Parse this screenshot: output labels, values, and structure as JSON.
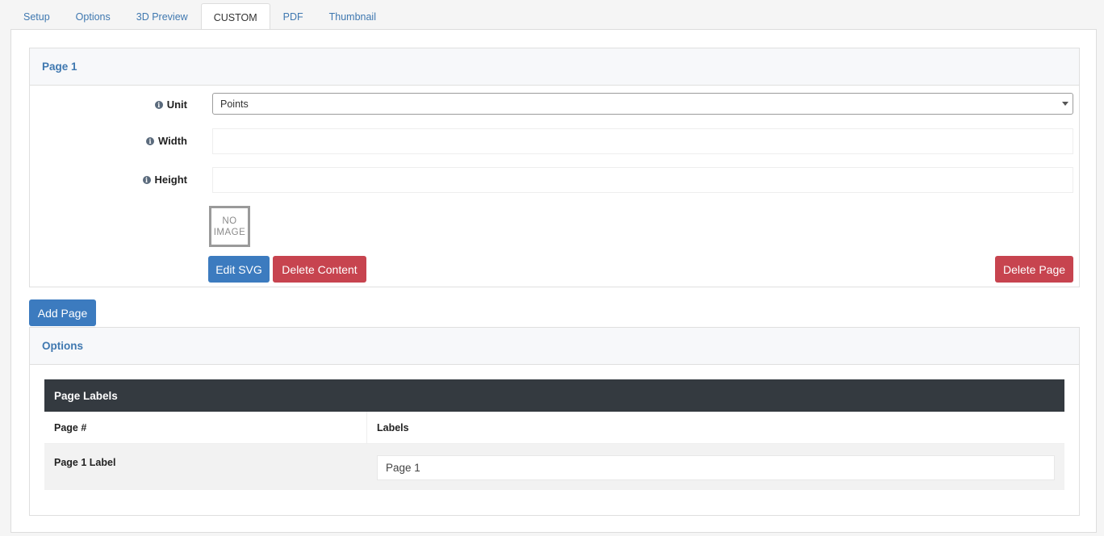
{
  "tabs": [
    {
      "label": "Setup",
      "active": false
    },
    {
      "label": "Options",
      "active": false
    },
    {
      "label": "3D Preview",
      "active": false
    },
    {
      "label": "CUSTOM",
      "active": true
    },
    {
      "label": "PDF",
      "active": false
    },
    {
      "label": "Thumbnail",
      "active": false
    }
  ],
  "page_card": {
    "title": "Page 1",
    "unit_label": "Unit",
    "unit_value": "Points",
    "width_label": "Width",
    "width_value": "",
    "height_label": "Height",
    "height_value": "",
    "no_image_text": "NO IMAGE",
    "edit_svg_label": "Edit SVG",
    "delete_content_label": "Delete Content",
    "delete_page_label": "Delete Page"
  },
  "add_page_label": "Add Page",
  "options_card": {
    "title": "Options",
    "table_title": "Page Labels",
    "columns": [
      "Page #",
      "Labels"
    ],
    "rows": [
      {
        "page": "Page 1 Label",
        "label_value": "Page 1"
      }
    ]
  },
  "colors": {
    "link": "#3f78b0",
    "primary": "#3c7bbf",
    "danger": "#c7444f",
    "dark_header": "#343a40"
  }
}
